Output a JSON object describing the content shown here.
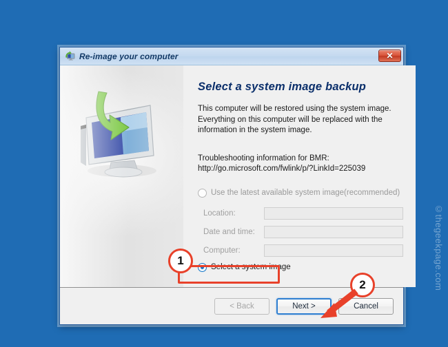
{
  "desktop": {
    "background_color": "#1f6cb4",
    "watermark": "©thegeekpage.com"
  },
  "dialog": {
    "titlebar": {
      "title": "Re-image your computer",
      "icon": "computer-restore-icon",
      "close_label": "✕"
    },
    "sidebar": {
      "illustration": "monitor-with-green-down-arrow-icon"
    },
    "content": {
      "heading": "Select a system image backup",
      "description_lines": [
        "This computer will be restored using the system image.",
        "Everything on this computer will be replaced with the",
        "information in the system image."
      ],
      "troubleshooting_label": "Troubleshooting information for BMR:",
      "troubleshooting_url": "http://go.microsoft.com/fwlink/p/?LinkId=225039",
      "options": [
        {
          "label": "Use the latest available system image(recommended)",
          "selected": false,
          "enabled": false
        },
        {
          "label": "Select a system image",
          "selected": true,
          "enabled": true
        }
      ],
      "fields": [
        {
          "label": "Location:",
          "value": "",
          "enabled": false
        },
        {
          "label": "Date and time:",
          "value": "",
          "enabled": false
        },
        {
          "label": "Computer:",
          "value": "",
          "enabled": false
        }
      ]
    },
    "footer": {
      "back_label": "< Back",
      "next_label": "Next >",
      "cancel_label": "Cancel"
    }
  },
  "annotations": {
    "color": "#e8412a",
    "step1": "1",
    "step2": "2"
  }
}
